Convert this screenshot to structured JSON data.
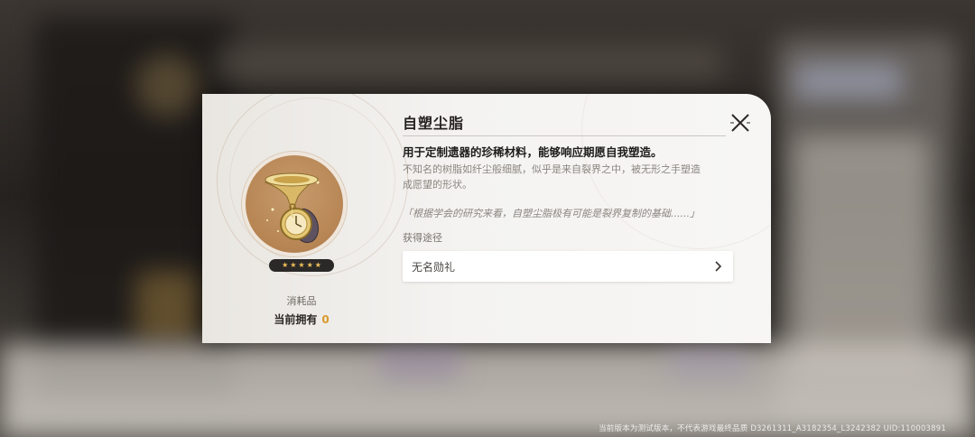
{
  "item": {
    "name": "自塑尘脂",
    "description": "用于定制遗器的珍稀材料，能够响应期愿自我塑造。",
    "lore_line1": "不知名的树脂如纤尘般细腻，似乎是来自裂界之中，被无形之手塑造",
    "lore_line2": "成愿望的形状。",
    "quote": "「根据学会的研究来看，自塑尘脂极有可能是裂界复制的基础......」",
    "rarity_stars": 5,
    "type_label": "消耗品",
    "owned_label": "当前拥有",
    "owned_count": "0",
    "icon": "pocket-watch-resin-icon"
  },
  "sources": {
    "label": "获得途径",
    "items": [
      {
        "label": "无名勋礼"
      }
    ]
  },
  "footer": {
    "watermark": "当前版本为测试版本，不代表游戏最终品质 D3261311_A3182354_L3242382 UID:110003891"
  },
  "colors": {
    "accent_gold": "#d99a2b",
    "star_gold": "#f2c15a",
    "portrait_bg": "#b78554"
  }
}
